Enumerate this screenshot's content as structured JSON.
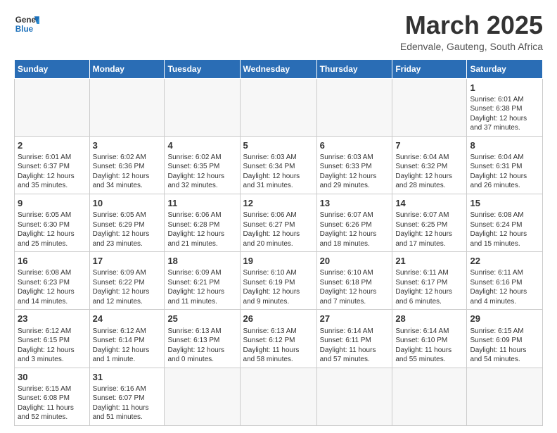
{
  "header": {
    "logo_general": "General",
    "logo_blue": "Blue",
    "title": "March 2025",
    "subtitle": "Edenvale, Gauteng, South Africa"
  },
  "columns": [
    "Sunday",
    "Monday",
    "Tuesday",
    "Wednesday",
    "Thursday",
    "Friday",
    "Saturday"
  ],
  "weeks": [
    [
      {
        "day": "",
        "info": ""
      },
      {
        "day": "",
        "info": ""
      },
      {
        "day": "",
        "info": ""
      },
      {
        "day": "",
        "info": ""
      },
      {
        "day": "",
        "info": ""
      },
      {
        "day": "",
        "info": ""
      },
      {
        "day": "1",
        "info": "Sunrise: 6:01 AM\nSunset: 6:38 PM\nDaylight: 12 hours\nand 37 minutes."
      }
    ],
    [
      {
        "day": "2",
        "info": "Sunrise: 6:01 AM\nSunset: 6:37 PM\nDaylight: 12 hours\nand 35 minutes."
      },
      {
        "day": "3",
        "info": "Sunrise: 6:02 AM\nSunset: 6:36 PM\nDaylight: 12 hours\nand 34 minutes."
      },
      {
        "day": "4",
        "info": "Sunrise: 6:02 AM\nSunset: 6:35 PM\nDaylight: 12 hours\nand 32 minutes."
      },
      {
        "day": "5",
        "info": "Sunrise: 6:03 AM\nSunset: 6:34 PM\nDaylight: 12 hours\nand 31 minutes."
      },
      {
        "day": "6",
        "info": "Sunrise: 6:03 AM\nSunset: 6:33 PM\nDaylight: 12 hours\nand 29 minutes."
      },
      {
        "day": "7",
        "info": "Sunrise: 6:04 AM\nSunset: 6:32 PM\nDaylight: 12 hours\nand 28 minutes."
      },
      {
        "day": "8",
        "info": "Sunrise: 6:04 AM\nSunset: 6:31 PM\nDaylight: 12 hours\nand 26 minutes."
      }
    ],
    [
      {
        "day": "9",
        "info": "Sunrise: 6:05 AM\nSunset: 6:30 PM\nDaylight: 12 hours\nand 25 minutes."
      },
      {
        "day": "10",
        "info": "Sunrise: 6:05 AM\nSunset: 6:29 PM\nDaylight: 12 hours\nand 23 minutes."
      },
      {
        "day": "11",
        "info": "Sunrise: 6:06 AM\nSunset: 6:28 PM\nDaylight: 12 hours\nand 21 minutes."
      },
      {
        "day": "12",
        "info": "Sunrise: 6:06 AM\nSunset: 6:27 PM\nDaylight: 12 hours\nand 20 minutes."
      },
      {
        "day": "13",
        "info": "Sunrise: 6:07 AM\nSunset: 6:26 PM\nDaylight: 12 hours\nand 18 minutes."
      },
      {
        "day": "14",
        "info": "Sunrise: 6:07 AM\nSunset: 6:25 PM\nDaylight: 12 hours\nand 17 minutes."
      },
      {
        "day": "15",
        "info": "Sunrise: 6:08 AM\nSunset: 6:24 PM\nDaylight: 12 hours\nand 15 minutes."
      }
    ],
    [
      {
        "day": "16",
        "info": "Sunrise: 6:08 AM\nSunset: 6:23 PM\nDaylight: 12 hours\nand 14 minutes."
      },
      {
        "day": "17",
        "info": "Sunrise: 6:09 AM\nSunset: 6:22 PM\nDaylight: 12 hours\nand 12 minutes."
      },
      {
        "day": "18",
        "info": "Sunrise: 6:09 AM\nSunset: 6:21 PM\nDaylight: 12 hours\nand 11 minutes."
      },
      {
        "day": "19",
        "info": "Sunrise: 6:10 AM\nSunset: 6:19 PM\nDaylight: 12 hours\nand 9 minutes."
      },
      {
        "day": "20",
        "info": "Sunrise: 6:10 AM\nSunset: 6:18 PM\nDaylight: 12 hours\nand 7 minutes."
      },
      {
        "day": "21",
        "info": "Sunrise: 6:11 AM\nSunset: 6:17 PM\nDaylight: 12 hours\nand 6 minutes."
      },
      {
        "day": "22",
        "info": "Sunrise: 6:11 AM\nSunset: 6:16 PM\nDaylight: 12 hours\nand 4 minutes."
      }
    ],
    [
      {
        "day": "23",
        "info": "Sunrise: 6:12 AM\nSunset: 6:15 PM\nDaylight: 12 hours\nand 3 minutes."
      },
      {
        "day": "24",
        "info": "Sunrise: 6:12 AM\nSunset: 6:14 PM\nDaylight: 12 hours\nand 1 minute."
      },
      {
        "day": "25",
        "info": "Sunrise: 6:13 AM\nSunset: 6:13 PM\nDaylight: 12 hours\nand 0 minutes."
      },
      {
        "day": "26",
        "info": "Sunrise: 6:13 AM\nSunset: 6:12 PM\nDaylight: 11 hours\nand 58 minutes."
      },
      {
        "day": "27",
        "info": "Sunrise: 6:14 AM\nSunset: 6:11 PM\nDaylight: 11 hours\nand 57 minutes."
      },
      {
        "day": "28",
        "info": "Sunrise: 6:14 AM\nSunset: 6:10 PM\nDaylight: 11 hours\nand 55 minutes."
      },
      {
        "day": "29",
        "info": "Sunrise: 6:15 AM\nSunset: 6:09 PM\nDaylight: 11 hours\nand 54 minutes."
      }
    ],
    [
      {
        "day": "30",
        "info": "Sunrise: 6:15 AM\nSunset: 6:08 PM\nDaylight: 11 hours\nand 52 minutes."
      },
      {
        "day": "31",
        "info": "Sunrise: 6:16 AM\nSunset: 6:07 PM\nDaylight: 11 hours\nand 51 minutes."
      },
      {
        "day": "",
        "info": ""
      },
      {
        "day": "",
        "info": ""
      },
      {
        "day": "",
        "info": ""
      },
      {
        "day": "",
        "info": ""
      },
      {
        "day": "",
        "info": ""
      }
    ]
  ]
}
